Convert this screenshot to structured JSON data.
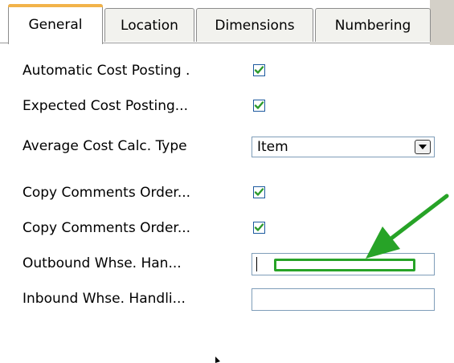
{
  "tabs": [
    {
      "label": "General",
      "active": true
    },
    {
      "label": "Location",
      "active": false
    },
    {
      "label": "Dimensions",
      "active": false
    },
    {
      "label": "Numbering",
      "active": false
    }
  ],
  "fields": {
    "automatic_cost_posting": {
      "label": "Automatic Cost Posting  .",
      "checked": true
    },
    "expected_cost_posting": {
      "label": "Expected Cost Posting...",
      "checked": true
    },
    "average_cost_calc_type": {
      "label": "Average Cost Calc. Type",
      "value": "Item"
    },
    "copy_comments_order_1": {
      "label": "Copy Comments Order...",
      "checked": true
    },
    "copy_comments_order_2": {
      "label": "Copy Comments Order...",
      "checked": true
    },
    "outbound_whse": {
      "label": "Outbound Whse. Han...",
      "value": ""
    },
    "inbound_whse": {
      "label": "Inbound Whse. Handli...",
      "value": ""
    }
  },
  "icons": {
    "checkmark": "check-icon",
    "dropdown": "dropdown-arrow-icon",
    "annotation": "green-arrow-icon"
  },
  "colors": {
    "checkmark": "#2e9b2e",
    "annotation": "#27a327",
    "active_tab_accent": "#f2b34a"
  }
}
